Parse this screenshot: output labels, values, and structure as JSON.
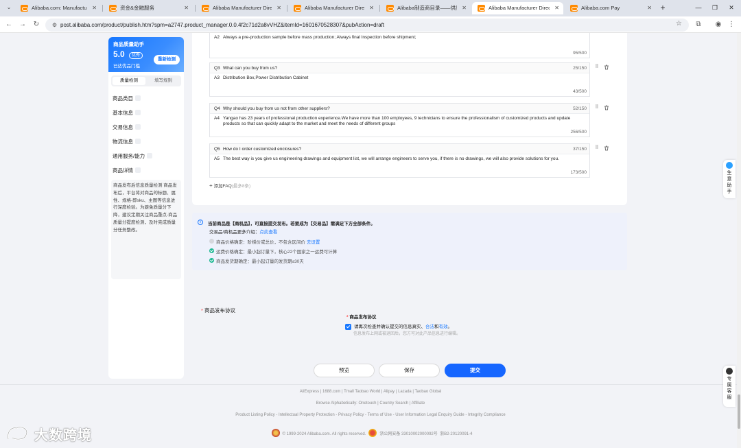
{
  "browser": {
    "tabs": [
      {
        "title": "Alibaba.com: Manufacturers,",
        "active": false
      },
      {
        "title": "资金&金融服务",
        "active": false
      },
      {
        "title": "Alibaba Manufacturer Directo",
        "active": false
      },
      {
        "title": "Alibaba Manufacturer Directo",
        "active": false
      },
      {
        "title": "Alibaba制造商目录——供应商",
        "active": false
      },
      {
        "title": "Alibaba Manufacturer Directo",
        "active": true
      },
      {
        "title": "Alibaba.com Pay",
        "active": false
      }
    ],
    "url": "post.alibaba.com/product/publish.htm?spm=a2747.product_manager.0.0.4f2c71d2a8vVHZ&itemId=1601670528307&pubAction=draft"
  },
  "quality_panel": {
    "title": "商品质量助手",
    "score": "5.0",
    "badge": "优秀",
    "subtitle": "已达优品门槛",
    "recheck": "重新检测",
    "tab_active": "质量检测",
    "tab_other": "填写规则",
    "sections": [
      "商品类目",
      "基本信息",
      "交易信息",
      "物流信息",
      "通用服务/能力",
      "商品详情"
    ],
    "note": "商品发布后信息质量检测 商品发布后，平台将对商品的标题、属性、规格-即sku、主图等信息进行深度检验。为避免质量分下降，建议定期关注商品重点-商品质量分提度检测，及时完成质量分任务整改。"
  },
  "faq": {
    "items": [
      {
        "q_no": "",
        "q": "",
        "q_count": "",
        "a_no": "A2",
        "a": "Always a pre-production sample before mass production; Always final Inspection before shipment;",
        "a_count": "95/500"
      },
      {
        "q_no": "Q3",
        "q": "What can you buy from us?",
        "q_count": "25/150",
        "a_no": "A3",
        "a": "Distribution Box,Power Distribution Cabinet",
        "a_count": "43/500"
      },
      {
        "q_no": "Q4",
        "q": "Why should you buy from us not from other suppliers?",
        "q_count": "52/150",
        "a_no": "A4",
        "a": "Yangao has 23 years of professional production experience.We have more than 100 employees, 9 technicians to ensure the professionalism of customized products and update products so that can quickly adapt to the market and meet the needs of different groups",
        "a_count": "256/500"
      },
      {
        "q_no": "Q5",
        "q": "How do I order customized enclosures?",
        "q_count": "37/150",
        "a_no": "A5",
        "a": "The best way is you give us engineering drawings and equipment list, we will arrange engineers to serve you, if there is no drawings, we will also provide solutions for you.",
        "a_count": "173/500"
      }
    ],
    "add_label": "添加FAQ",
    "add_limit": "(最多8条)"
  },
  "notice": {
    "line1_a": "当前商品是【商机品】，可直接提交发布。若要成为【交易品】需满足下方全部条件。",
    "line2_a": "交易品/商机品更多介绍：",
    "line2_link": "点此查看",
    "conditions": [
      {
        "text": "商品价格确定：阶梯价或总价，不包含区间价 ",
        "link": "去设置",
        "ok": false
      },
      {
        "text": "运费价格确定：最小起订量下，核心22个国家之一运费可计算",
        "link": "",
        "ok": true
      },
      {
        "text": "商品发货期确定：最小起订量的发货期≤30天",
        "link": "",
        "ok": true
      }
    ]
  },
  "agreement": {
    "label": "商品发布协议",
    "sub_label": "商品发布协议",
    "text": "请再次检查并确认提交的信息真实、",
    "link1": "合法",
    "and": "和",
    "link2": "有效",
    "end": "。",
    "tip": "信息发布上网或被退回后，您方可对此产品信息进行编辑。"
  },
  "actions": {
    "preview": "预览",
    "save": "保存",
    "submit": "提交"
  },
  "footer": {
    "line1": "AliExpress | 1688.com | Tmall Taobao World | Alipay | Lazada | Taobao Global",
    "line2": "Browse Alphabetically: Onetouch | Country Search | Affiliate",
    "line3": "Product Listing Policy - Intellectual Property Protection - Privacy Policy - Terms of Use - User Information Legal Enquiry Guide - Integrity Compliance",
    "copyright": "© 1999-2024 Alibaba.com. All rights reserved.",
    "icp1": "浙公网安备 33010002000092号",
    "icp2": "浙B2-20120091-4"
  },
  "helpers": {
    "business": "生意助手",
    "service": "专属客服"
  },
  "watermark": "大数跨境"
}
